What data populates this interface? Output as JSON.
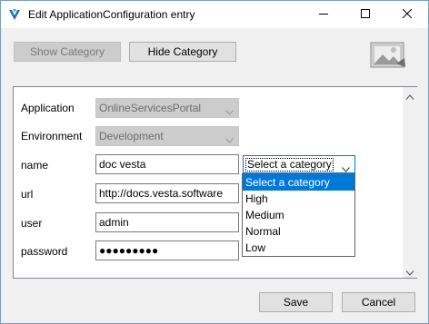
{
  "window": {
    "title": "Edit ApplicationConfiguration entry",
    "accent": "#0078d7"
  },
  "toolbar": {
    "show_category_label": "Show Category",
    "hide_category_label": "Hide Category"
  },
  "form": {
    "fields": [
      {
        "label": "Application",
        "value": "OnlineServicesPortal",
        "kind": "combo",
        "enabled": false
      },
      {
        "label": "Environment",
        "value": "Development",
        "kind": "combo",
        "enabled": false
      },
      {
        "label": "name",
        "value": "doc vesta",
        "kind": "text"
      },
      {
        "label": "url",
        "value": "http://docs.vesta.software",
        "kind": "text"
      },
      {
        "label": "user",
        "value": "admin",
        "kind": "text"
      },
      {
        "label": "password",
        "value": "●●●●●●●●●",
        "kind": "password"
      }
    ]
  },
  "category": {
    "selected": "Select a category",
    "options": [
      "Select a category",
      "High",
      "Medium",
      "Normal",
      "Low"
    ],
    "highlighted_index": 0
  },
  "footer": {
    "save_label": "Save",
    "cancel_label": "Cancel"
  },
  "icons": {
    "app": "vesta-logo-icon",
    "minimize": "minimize-icon",
    "maximize": "maximize-icon",
    "close": "close-icon",
    "photo": "image-placeholder-icon",
    "scroll_up": "chevron-up-icon",
    "scroll_down": "chevron-down-icon"
  }
}
